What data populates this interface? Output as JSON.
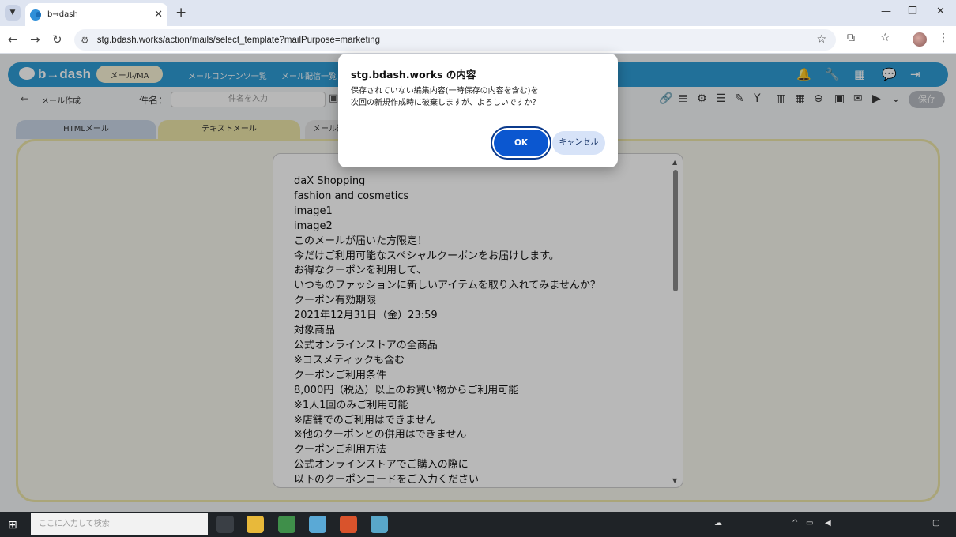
{
  "browser": {
    "tab_title": "b→dash",
    "url": "stg.bdash.works/action/mails/select_template?mailPurpose=marketing",
    "icons": [
      "chevron-down-icon",
      "close-icon",
      "plus-icon",
      "minimize-icon",
      "restore-icon",
      "close-window-icon",
      "back-icon",
      "forward-icon",
      "reload-icon",
      "site-info-icon",
      "bookmark-star-icon",
      "extensions-icon",
      "bookmarks-icon",
      "profile-avatar",
      "more-icon"
    ]
  },
  "app": {
    "logo": "b→dash",
    "pill": "メール/MA",
    "nav": [
      "メールコンテンツ一覧",
      "メール配信一覧"
    ],
    "breadcrumb": "メール作成",
    "subject_label": "件名：",
    "subject_placeholder": "件名を入力",
    "save_label": "保存",
    "tabs": [
      "HTMLメール",
      "テキストメール",
      "メール形"
    ],
    "accent_color": "#2f9bd4"
  },
  "mail_body": [
    "daX Shopping",
    "fashion and cosmetics",
    "image1",
    "image2",
    "このメールが届いた方限定！",
    "今だけご利用可能なスペシャルクーポンをお届けします。",
    "お得なクーポンを利用して、",
    "いつものファッションに新しいアイテムを取り入れてみませんか？",
    "クーポン有効期限",
    "2021年12月31日（金）23:59",
    "対象商品",
    "公式オンラインストアの全商品",
    "※コスメティックも含む",
    "クーポンご利用条件",
    "8,000円（税込）以上のお買い物からご利用可能",
    "※1人1回のみご利用可能",
    "※店舗でのご利用はできません",
    "※他のクーポンとの併用はできません",
    "クーポンご利用方法",
    "公式オンラインストアでご購入の際に",
    "以下のクーポンコードをご入力ください"
  ],
  "dialog": {
    "title": "stg.bdash.works の内容",
    "message_line1": "保存されていない編集内容(一時保存の内容を含む)を",
    "message_line2": "次回の新規作成時に破棄しますが、よろしいですか？",
    "ok_label": "OK",
    "cancel_label": "キャンセル"
  },
  "taskbar": {
    "search_placeholder": "ここに入力して検索"
  }
}
